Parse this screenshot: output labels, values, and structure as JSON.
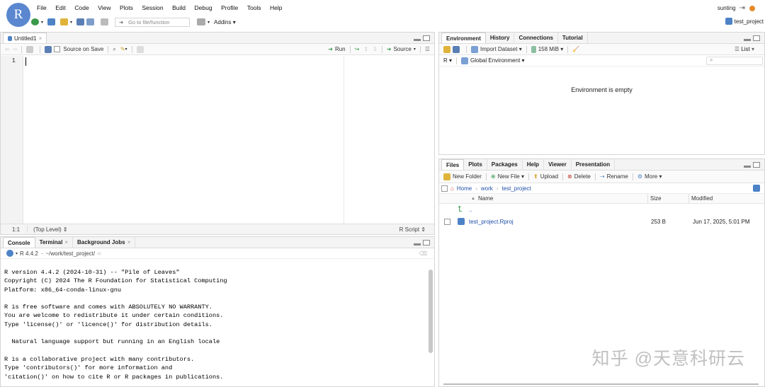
{
  "logo": "R",
  "menu": [
    "File",
    "Edit",
    "Code",
    "View",
    "Plots",
    "Session",
    "Build",
    "Debug",
    "Profile",
    "Tools",
    "Help"
  ],
  "toolbar": {
    "goto_placeholder": "Go to file/function",
    "addins": "Addins"
  },
  "user": "sunting",
  "project": "test_project",
  "editor": {
    "tab": "Untitled1",
    "source_on_save": "Source on Save",
    "run": "Run",
    "source": "Source",
    "line_number": "1",
    "position": "1:1",
    "scope": "(Top Level)",
    "filetype": "R Script"
  },
  "console": {
    "tabs": [
      "Console",
      "Terminal",
      "Background Jobs"
    ],
    "version": "R 4.4.2",
    "path": "~/work/test_project/",
    "lines": [
      "R version 4.4.2 (2024-10-31) -- \"Pile of Leaves\"",
      "Copyright (C) 2024 The R Foundation for Statistical Computing",
      "Platform: x86_64-conda-linux-gnu",
      "",
      "R is free software and comes with ABSOLUTELY NO WARRANTY.",
      "You are welcome to redistribute it under certain conditions.",
      "Type 'license()' or 'licence()' for distribution details.",
      "",
      "  Natural language support but running in an English locale",
      "",
      "R is a collaborative project with many contributors.",
      "Type 'contributors()' for more information and",
      "'citation()' on how to cite R or R packages in publications."
    ]
  },
  "env": {
    "tabs": [
      "Environment",
      "History",
      "Connections",
      "Tutorial"
    ],
    "import": "Import Dataset",
    "memory": "158 MiB",
    "list": "List",
    "lang": "R",
    "scope": "Global Environment",
    "empty": "Environment is empty"
  },
  "files": {
    "tabs": [
      "Files",
      "Plots",
      "Packages",
      "Help",
      "Viewer",
      "Presentation"
    ],
    "actions": {
      "new_folder": "New Folder",
      "new_file": "New File",
      "upload": "Upload",
      "delete": "Delete",
      "rename": "Rename",
      "more": "More"
    },
    "breadcrumb": [
      "Home",
      "work",
      "test_project"
    ],
    "headers": {
      "name": "Name",
      "size": "Size",
      "modified": "Modified"
    },
    "parent": "..",
    "rows": [
      {
        "name": "test_project.Rproj",
        "size": "253 B",
        "modified": "Jun 17, 2025, 5:01 PM"
      }
    ]
  },
  "watermark": "知乎 @天意科研云",
  "colors": {
    "accent": "#5a87cf",
    "link": "#1f4fa8",
    "run_green": "#3a9a4a"
  }
}
